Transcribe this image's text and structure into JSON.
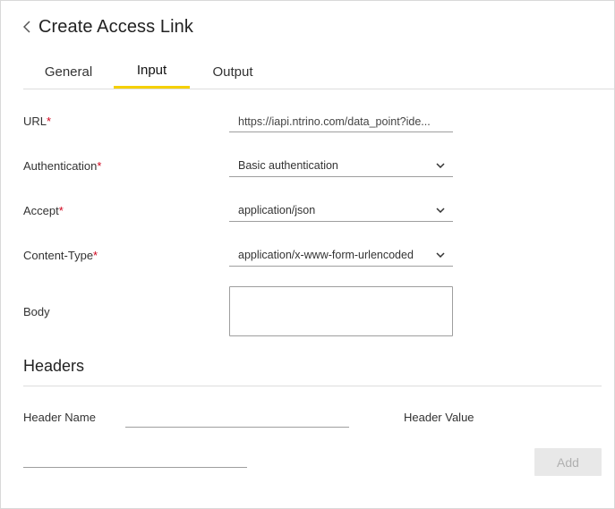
{
  "header": {
    "title": "Create Access Link",
    "back_icon": "chevron-left-icon"
  },
  "tabs": [
    {
      "label": "General",
      "active": false
    },
    {
      "label": "Input",
      "active": true
    },
    {
      "label": "Output",
      "active": false
    }
  ],
  "colors": {
    "active_tab_indicator": "#f5d000",
    "required_marker": "#d0021b",
    "disabled_button_bg": "#e8e8e8"
  },
  "form": {
    "url": {
      "label": "URL",
      "required": "*",
      "value": "https://iapi.ntrino.com/data_point?ide..."
    },
    "authentication": {
      "label": "Authentication",
      "required": "*",
      "value": "Basic authentication",
      "icon": "chevron-down-icon"
    },
    "accept": {
      "label": "Accept",
      "required": "*",
      "value": "application/json",
      "icon": "chevron-down-icon"
    },
    "content_type": {
      "label": "Content-Type",
      "required": "*",
      "value": "application/x-www-form-urlencoded",
      "icon": "chevron-down-icon"
    },
    "body": {
      "label": "Body",
      "value": ""
    }
  },
  "headers_section": {
    "title": "Headers",
    "header_name_label": "Header Name",
    "header_name_value": "",
    "header_value_label": "Header Value",
    "header_value_value": "",
    "add_label": "Add",
    "add_enabled": false
  }
}
